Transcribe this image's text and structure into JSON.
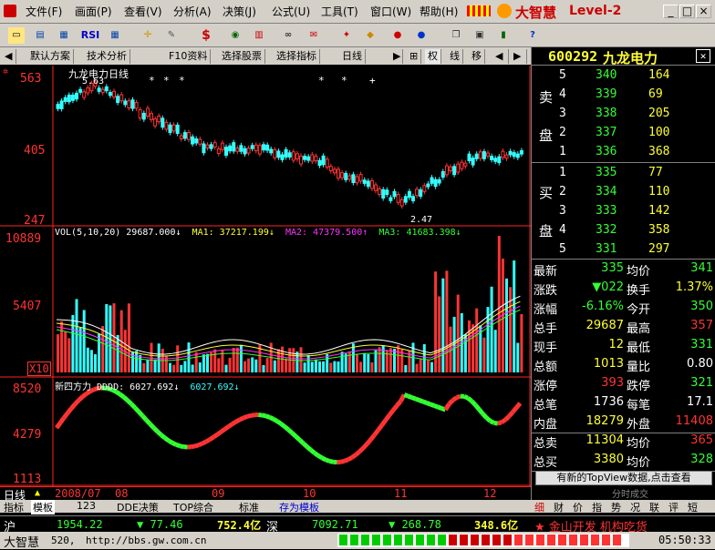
{
  "window": {
    "logo": "大智慧",
    "level": "Level-2",
    "controls": [
      "_",
      "□",
      "×"
    ]
  },
  "menu": [
    {
      "label": "文件(F)"
    },
    {
      "label": "画面(P)"
    },
    {
      "label": "查看(V)"
    },
    {
      "label": "分析(A)"
    },
    {
      "label": "决策(J)"
    },
    {
      "label": "公式(U)"
    },
    {
      "label": "工具(T)"
    },
    {
      "label": "窗口(W)"
    },
    {
      "label": "帮助(H)"
    }
  ],
  "tabs": [
    {
      "label": "默认方案"
    },
    {
      "label": "技术分析"
    },
    {
      "label": "F10资料"
    },
    {
      "label": "选择股票"
    },
    {
      "label": "选择指标"
    },
    {
      "label": "日线"
    },
    {
      "label": "权"
    },
    {
      "label": "线"
    },
    {
      "label": "移"
    }
  ],
  "stock": {
    "code": "600292",
    "name": "九龙电力"
  },
  "price_chart": {
    "title": "九龙电力日线",
    "max_label": "5.63",
    "min_label": "2.47",
    "y_ticks": [
      "563",
      "405",
      "247"
    ]
  },
  "vol_chart": {
    "header": "VOL(5,10,20)",
    "vol": "29687.000↓",
    "ma1_label": "MA1:",
    "ma1": "37217.199↓",
    "ma2_label": "MA2:",
    "ma2": "47379.500↑",
    "ma3_label": "MA3:",
    "ma3": "41683.398↓",
    "y_ticks": [
      "10889",
      "5407"
    ],
    "unit": "X10"
  },
  "ind_chart": {
    "header": "新四方力 DDDD:",
    "v1": "6027.692↓",
    "v2": "6027.692↓",
    "y_ticks": [
      "8520",
      "4279",
      "1113"
    ]
  },
  "xaxis": {
    "labels": [
      "2008/07",
      "08",
      "09",
      "10",
      "11",
      "12"
    ]
  },
  "period": "日线",
  "bottom_tabs": [
    "指标",
    "模板",
    "123",
    "DDE决策",
    "TOP综合",
    "标准",
    "存为模板"
  ],
  "orderbook": {
    "sell": [
      {
        "lvl": "5",
        "price": "340",
        "vol": "164"
      },
      {
        "lvl": "4",
        "price": "339",
        "vol": "69"
      },
      {
        "lvl": "3",
        "price": "338",
        "vol": "205"
      },
      {
        "lvl": "2",
        "price": "337",
        "vol": "100"
      },
      {
        "lvl": "1",
        "price": "336",
        "vol": "368"
      }
    ],
    "buy": [
      {
        "lvl": "1",
        "price": "335",
        "vol": "77"
      },
      {
        "lvl": "2",
        "price": "334",
        "vol": "110"
      },
      {
        "lvl": "3",
        "price": "333",
        "vol": "142"
      },
      {
        "lvl": "4",
        "price": "332",
        "vol": "358"
      },
      {
        "lvl": "5",
        "price": "331",
        "vol": "297"
      }
    ],
    "sell_label": [
      "卖",
      "盘"
    ],
    "buy_label": [
      "买",
      "盘"
    ]
  },
  "quote": [
    {
      "l": "最新",
      "v": "335",
      "l2": "均价",
      "v2": "341"
    },
    {
      "l": "涨跌",
      "v": "▼022",
      "l2": "换手",
      "v2": "1.37%"
    },
    {
      "l": "涨幅",
      "v": "-6.16%",
      "l2": "今开",
      "v2": "350"
    },
    {
      "l": "总手",
      "v": "29687",
      "l2": "最高",
      "v2": "357"
    },
    {
      "l": "现手",
      "v": "12",
      "l2": "最低",
      "v2": "331"
    },
    {
      "l": "总额",
      "v": "1013",
      "l2": "量比",
      "v2": "0.80"
    },
    {
      "l": "涨停",
      "v": "393",
      "l2": "跌停",
      "v2": "321"
    },
    {
      "l": "总笔",
      "v": "1736",
      "l2": "每笔",
      "v2": "17.1"
    },
    {
      "l": "内盘",
      "v": "18279",
      "l2": "外盘",
      "v2": "11408"
    },
    {
      "l": "总卖",
      "v": "11304",
      "l2": "均价",
      "v2": "365"
    },
    {
      "l": "总买",
      "v": "3380",
      "l2": "均价",
      "v2": "328"
    }
  ],
  "topview": "有新的TopView数据,点击查看",
  "split_label": "分时成交",
  "right_tabs": [
    "细",
    "财",
    "价",
    "指",
    "势",
    "况",
    "联",
    "评",
    "短"
  ],
  "status": {
    "sh": "沪",
    "sh_idx": "1954.22",
    "sh_chg": "▼ 77.46",
    "sh_amt": "752.4亿",
    "sz": "深",
    "sz_idx": "7092.71",
    "sz_chg": "▼ 268.78",
    "sz_amt": "348.6亿",
    "news": "★ 金山开发 机构吃货"
  },
  "status2": {
    "app": "大智慧",
    "port": "520,",
    "url": "http://bbs.gw.com.cn",
    "time": "05:50:33"
  },
  "colors": {
    "up": "#ff3333",
    "down": "#33ffff",
    "accent": "#ffff00"
  }
}
